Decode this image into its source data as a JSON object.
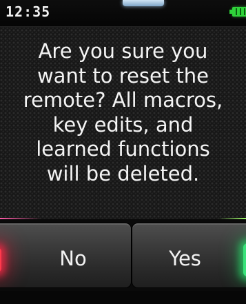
{
  "status_bar": {
    "time": "12:35",
    "battery_icon": "battery-full-icon",
    "battery_color": "#2fd43a"
  },
  "dialog": {
    "message": "Are you sure you\nwant to reset the\nremote? All macros,\nkey edits, and\nlearned functions\nwill be deleted."
  },
  "buttons": {
    "no_label": "No",
    "yes_label": "Yes",
    "no_indicator_color": "#ff3a4c",
    "yes_indicator_color": "#39e27a"
  }
}
